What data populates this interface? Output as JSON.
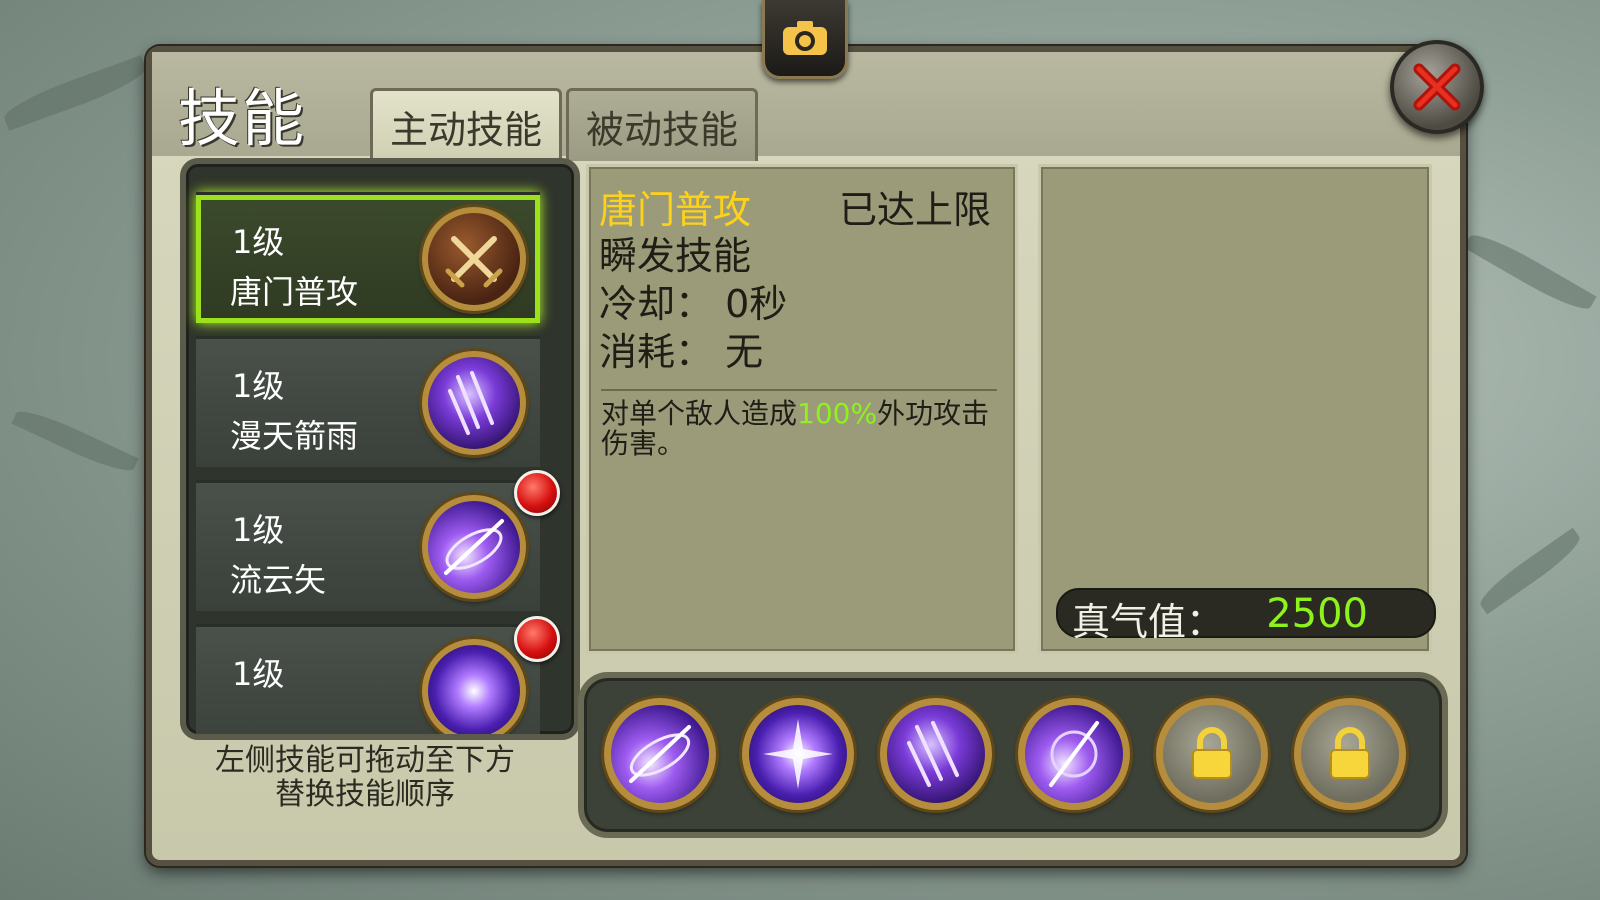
{
  "window": {
    "title": "技能",
    "tabs": [
      {
        "label": "主动技能",
        "active": true
      },
      {
        "label": "被动技能",
        "active": false
      }
    ]
  },
  "skill_list": [
    {
      "level": "1级",
      "name": "唐门普攻",
      "icon": "crossed-swords-icon",
      "selected": true,
      "has_notification": false
    },
    {
      "level": "1级",
      "name": "漫天箭雨",
      "icon": "arrow-rain-icon",
      "selected": false,
      "has_notification": false
    },
    {
      "level": "1级",
      "name": "流云矢",
      "icon": "flowing-cloud-arrow-icon",
      "selected": false,
      "has_notification": true
    },
    {
      "level": "1级",
      "name": "",
      "icon": "burst-icon",
      "selected": false,
      "has_notification": true
    }
  ],
  "hint": {
    "line1": "左侧技能可拖动至下方",
    "line2": "替换技能顺序"
  },
  "detail": {
    "name": "唐门普攻",
    "status": "已达上限",
    "type": "瞬发技能",
    "cooldown": "冷却：  0秒",
    "cost": "消耗：  无",
    "desc_pre": "对单个敌人造成",
    "desc_highlight": "100%",
    "desc_post": "外功攻击伤害。"
  },
  "qi": {
    "label": "真气值：",
    "value": "2500"
  },
  "skill_bar": [
    {
      "icon": "flowing-cloud-arrow-icon",
      "locked": false
    },
    {
      "icon": "burst-icon",
      "locked": false
    },
    {
      "icon": "arrow-rain-icon",
      "locked": false
    },
    {
      "icon": "vortex-arrow-icon",
      "locked": false
    },
    {
      "icon": "lock-icon",
      "locked": true
    },
    {
      "icon": "lock-icon",
      "locked": true
    }
  ],
  "colors": {
    "skill_name_highlight": "#ffd21a",
    "value_green": "#8ef21d",
    "selected_glow": "#9be21d"
  }
}
